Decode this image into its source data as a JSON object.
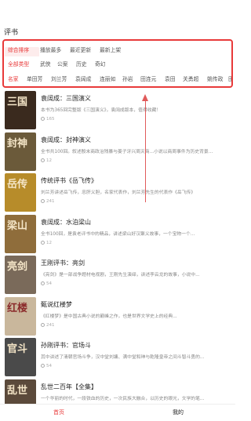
{
  "header": {
    "title": "评书"
  },
  "filters": {
    "sort": [
      "综合排序",
      "播放最多",
      "最近更新",
      "最新上架"
    ],
    "types": [
      "全部类型",
      "武侠",
      "公案",
      "历史",
      "奇幻"
    ],
    "artists": [
      "名家",
      "单田芳",
      "刘兰芳",
      "袁阔成",
      "连丽如",
      "孙岩",
      "田连元",
      "袁田",
      "关勇超",
      "姚传政",
      "田"
    ]
  },
  "books": [
    {
      "title": "袁阔成：三国演义",
      "desc": "本书为365回完整版《三国演义》，袁阔成版本，值得收藏！",
      "plays": "165",
      "cover": "三国",
      "bg": "#3a2a1e"
    },
    {
      "title": "袁阔成：封神演义",
      "desc": "全书共100回。叙述殷末商政治残暴与姜子牙兴周灭商...小说以商周事件为历史背景...",
      "plays": "12",
      "cover": "封神",
      "bg": "#6b5a3a"
    },
    {
      "title": "传统评书《岳飞传》",
      "desc": "刘兰芳讲述岳飞传，忠肝义胆，名家代表作，刘兰芳先生的代表作《岳飞传》",
      "plays": "241",
      "cover": "岳传",
      "bg": "#b78c2a"
    },
    {
      "title": "袁阔成：水泊梁山",
      "desc": "全书100回，是袁老评书中的精品，讲述梁山好汉聚义故事，一个宝物一个...",
      "plays": "12",
      "cover": "梁山",
      "bg": "#8f6d3b"
    },
    {
      "title": "王刚评书：亮剑",
      "desc": "《亮剑》是一部战争题材电视剧，王刚先生演绎，讲述李云龙的故事，小说中...",
      "plays": "54",
      "cover": "亮剑",
      "bg": "#7a6a5a"
    },
    {
      "title": "甄说红楼梦",
      "desc": "《红楼梦》是中国古典小说的巅峰之作，也是世界文学史上的经典...",
      "plays": "241",
      "cover": "红楼",
      "bg": "#c9b79c"
    },
    {
      "title": "孙刚评书：官场斗",
      "desc": "其中讲述了清朝官场斗争，汉中堂刘墉、满中堂和珅与乾隆皇帝之间斗智斗勇的...",
      "plays": "54",
      "cover": "官斗",
      "bg": "#4a4a4a"
    },
    {
      "title": "乱世二百年【全集】",
      "desc": "一个华丽的时代，一段铁血的历史，一次民族大融合，以历史的眼光，文学的笔...",
      "plays": "12",
      "cover": "乱世",
      "bg": "#5b4a3b"
    }
  ],
  "tabbar": {
    "home": "首页",
    "mine": "我的"
  }
}
